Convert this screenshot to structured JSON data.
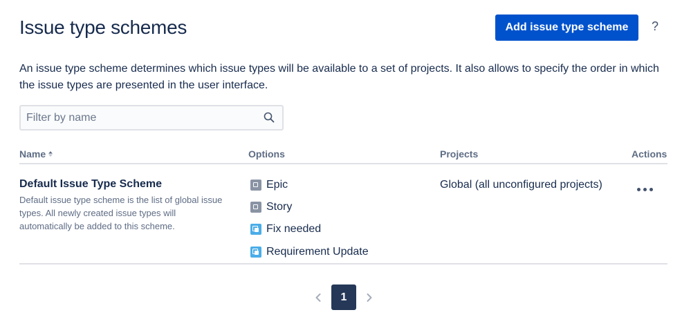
{
  "header": {
    "title": "Issue type schemes",
    "add_button_label": "Add issue type scheme",
    "help_label": "?"
  },
  "description": "An issue type scheme determines which issue types will be available to a set of projects. It also allows to specify the order in which the issue types are presented in the user interface.",
  "filter": {
    "placeholder": "Filter by name",
    "value": "",
    "icon": "search-icon"
  },
  "table": {
    "columns": [
      "Name",
      "Options",
      "Projects",
      "Actions"
    ],
    "sort_column": "Name",
    "rows": [
      {
        "name": "Default Issue Type Scheme",
        "description": "Default issue type scheme is the list of global issue types. All newly created issue types will automatically be added to this scheme.",
        "options": [
          {
            "label": "Epic",
            "icon": "epic-issue-icon",
            "color": "#8993a4"
          },
          {
            "label": "Story",
            "icon": "story-issue-icon",
            "color": "#8993a4"
          },
          {
            "label": "Fix needed",
            "icon": "fix-needed-issue-icon",
            "color": "#4bade8"
          },
          {
            "label": "Requirement Update",
            "icon": "requirement-update-issue-icon",
            "color": "#4bade8"
          }
        ],
        "projects": "Global (all unconfigured projects)",
        "actions_icon": "more-actions-icon"
      }
    ]
  },
  "pagination": {
    "current_page": "1",
    "pages": [
      "1"
    ]
  },
  "colors": {
    "primary": "#0052cc",
    "text": "#172b4d",
    "subtle_text": "#5e6c84",
    "current_page_bg": "#253858",
    "border": "#dfe1e6"
  }
}
